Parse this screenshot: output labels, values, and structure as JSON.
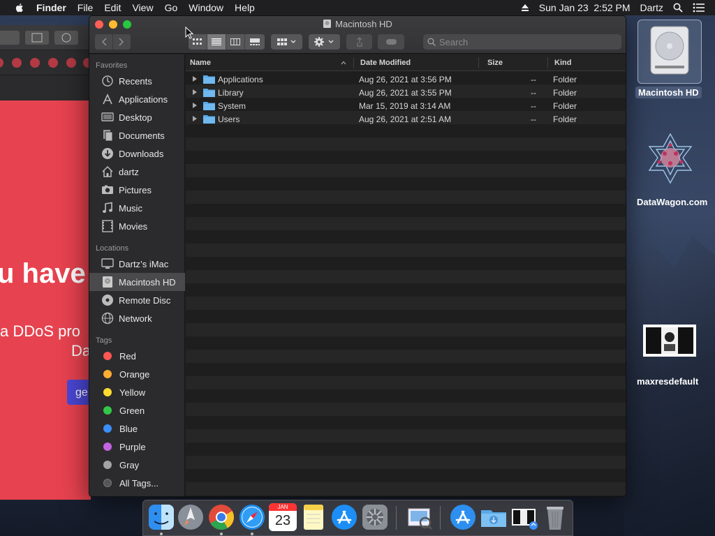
{
  "menubar": {
    "app_name": "Finder",
    "items": [
      "File",
      "Edit",
      "View",
      "Go",
      "Window",
      "Help"
    ],
    "datetime": "Sun Jan 23  2:52 PM",
    "user": "Dartz"
  },
  "background_window": {
    "headline": "u have",
    "line1": "a DDoS pro",
    "line2": "Da",
    "button": "ge",
    "page_color": "#e7424f"
  },
  "finder": {
    "title": "Macintosh HD",
    "search_placeholder": "Search",
    "sidebar": {
      "favorites_header": "Favorites",
      "favorites": [
        {
          "label": "Recents",
          "icon": "recents-icon"
        },
        {
          "label": "Applications",
          "icon": "applications-icon"
        },
        {
          "label": "Desktop",
          "icon": "desktop-icon"
        },
        {
          "label": "Documents",
          "icon": "documents-icon"
        },
        {
          "label": "Downloads",
          "icon": "downloads-icon"
        },
        {
          "label": "dartz",
          "icon": "home-icon"
        },
        {
          "label": "Pictures",
          "icon": "pictures-icon"
        },
        {
          "label": "Music",
          "icon": "music-icon"
        },
        {
          "label": "Movies",
          "icon": "movies-icon"
        }
      ],
      "locations_header": "Locations",
      "locations": [
        {
          "label": "Dartz’s iMac",
          "icon": "imac-icon"
        },
        {
          "label": "Macintosh HD",
          "icon": "hard-drive-icon",
          "selected": true
        },
        {
          "label": "Remote Disc",
          "icon": "remote-disc-icon"
        },
        {
          "label": "Network",
          "icon": "network-icon"
        }
      ],
      "tags_header": "Tags",
      "tags": [
        {
          "label": "Red",
          "color": "#fc5753"
        },
        {
          "label": "Orange",
          "color": "#fdae33"
        },
        {
          "label": "Yellow",
          "color": "#fcda2f"
        },
        {
          "label": "Green",
          "color": "#34c749"
        },
        {
          "label": "Blue",
          "color": "#3b8ff8"
        },
        {
          "label": "Purple",
          "color": "#c464e0"
        },
        {
          "label": "Gray",
          "color": "#a3a3a6"
        },
        {
          "label": "All Tags...",
          "color": "#555"
        }
      ]
    },
    "columns": {
      "name": "Name",
      "date": "Date Modified",
      "size": "Size",
      "kind": "Kind"
    },
    "rows": [
      {
        "name": "Applications",
        "date": "Aug 26, 2021 at 3:56 PM",
        "size": "--",
        "kind": "Folder"
      },
      {
        "name": "Library",
        "date": "Aug 26, 2021 at 3:55 PM",
        "size": "--",
        "kind": "Folder"
      },
      {
        "name": "System",
        "date": "Mar 15, 2019 at 3:14 AM",
        "size": "--",
        "kind": "Folder"
      },
      {
        "name": "Users",
        "date": "Aug 26, 2021 at 2:51 AM",
        "size": "--",
        "kind": "Folder"
      }
    ]
  },
  "desktop": {
    "icons": [
      {
        "label": "Macintosh HD"
      },
      {
        "label": "DataWagon.com"
      },
      {
        "label": "maxresdefault"
      }
    ]
  },
  "dock": {
    "apps": [
      "Finder",
      "Launchpad",
      "Google Chrome",
      "Safari",
      "Calendar",
      "Notes",
      "App Store",
      "System Preferences",
      "Preview",
      "Applications",
      "Downloads",
      "maxresdefault",
      "Trash"
    ],
    "calendar_month": "JAN",
    "calendar_day": "23"
  }
}
